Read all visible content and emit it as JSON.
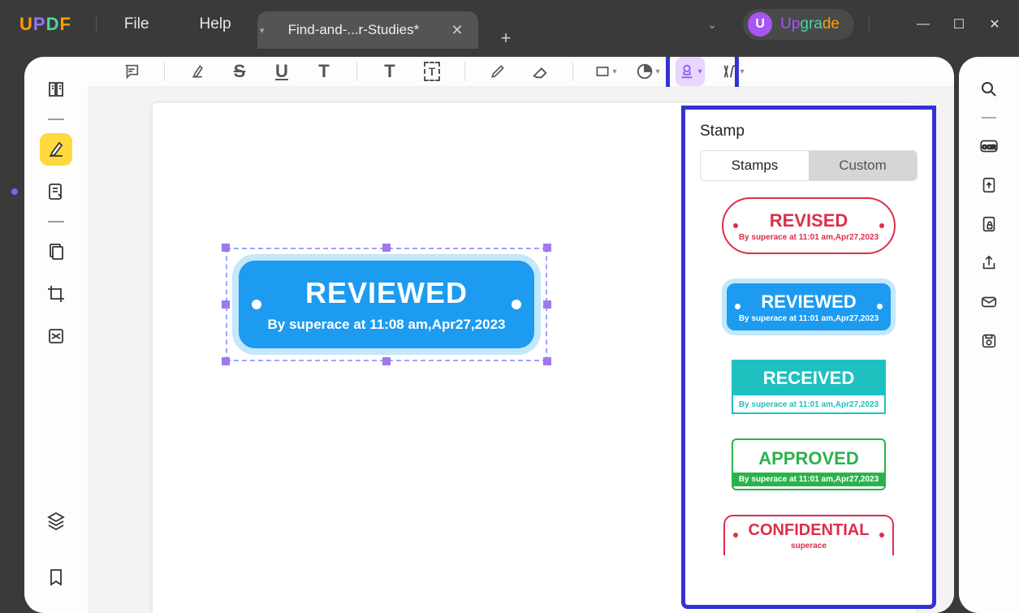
{
  "titlebar": {
    "logo": "UPDF",
    "menu": {
      "file": "File",
      "help": "Help"
    },
    "tab": {
      "title": "Find-and-...r-Studies*",
      "close": "✕"
    },
    "add_tab": "+",
    "upgrade": {
      "avatar_letter": "U",
      "label": "Upgrade"
    },
    "window": {
      "min": "—",
      "max": "☐",
      "close": "✕"
    }
  },
  "canvas_stamp": {
    "title": "REVIEWED",
    "subtitle": "By superace at 11:08 am,Apr27,2023"
  },
  "stamp_panel": {
    "title": "Stamp",
    "tabs": {
      "stamps": "Stamps",
      "custom": "Custom"
    },
    "items": {
      "revised": {
        "title": "REVISED",
        "sub": "By superace at 11:01 am,Apr27,2023"
      },
      "reviewed": {
        "title": "REVIEWED",
        "sub": "By superace at 11:01 am,Apr27,2023"
      },
      "received": {
        "title": "RECEIVED",
        "sub": "By superace at 11:01 am,Apr27,2023"
      },
      "approved": {
        "title": "APPROVED",
        "sub": "By superace at 11:01 am,Apr27,2023"
      },
      "confidential": {
        "title": "CONFIDENTIAL",
        "sub": "superace"
      }
    }
  }
}
